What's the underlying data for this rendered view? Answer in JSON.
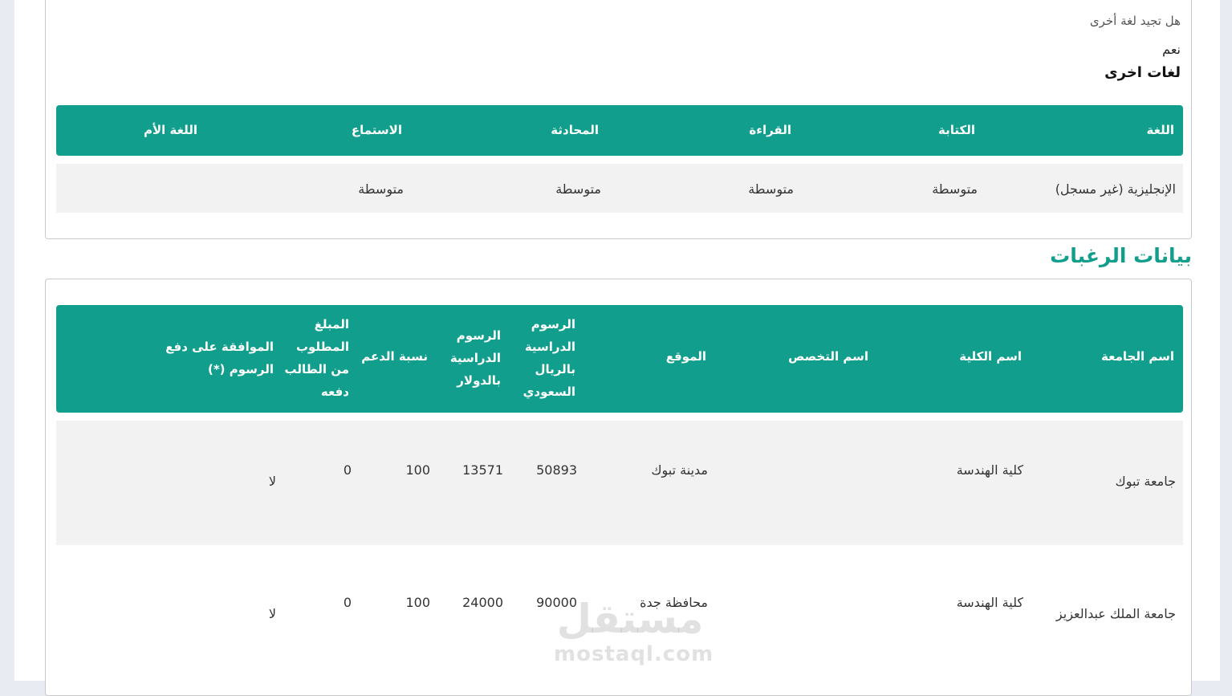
{
  "languages_section": {
    "question_label": "هل تجيد لغة أخرى",
    "question_value": "نعم",
    "subtitle": "لغات اخرى",
    "headers": [
      "اللغة",
      "الكتابة",
      "القراءة",
      "المحادثة",
      "الاستماع",
      "اللغة الأم"
    ],
    "rows": [
      {
        "language": "الإنجليزية  (غير مسجل)",
        "writing": "متوسطة",
        "reading": "متوسطة",
        "speaking": "متوسطة",
        "listening": "متوسطة",
        "native": ""
      }
    ]
  },
  "preferences_section": {
    "title": "بيانات الرغبات",
    "headers": {
      "university": "اسم الجامعة",
      "college": "اسم الكلية",
      "major": "اسم التخصص",
      "location": "الموقع",
      "fees_sar_lines": [
        "الرسوم",
        "الدراسية",
        "بالريال",
        "السعودي"
      ],
      "fees_usd_lines": [
        "الرسوم",
        "الدراسية",
        "بالدولار"
      ],
      "support": "نسبة الدعم",
      "amount_lines": [
        "المبلغ",
        "المطلوب",
        "من الطالب",
        "دفعه"
      ],
      "agree_lines": [
        "الموافقة على دفع",
        "الرسوم (*)"
      ]
    },
    "rows": [
      {
        "university": "جامعة تبوك",
        "college": "كلية الهندسة",
        "major": "",
        "location": "مدينة تبوك",
        "fees_sar": "50893",
        "fees_usd": "13571",
        "support": "100",
        "amount": "0",
        "agree": "لا"
      },
      {
        "university": "جامعة الملك عبدالعزيز",
        "college": "كلية الهندسة",
        "major": "",
        "location": "محافظة جدة",
        "fees_sar": "90000",
        "fees_usd": "24000",
        "support": "100",
        "amount": "0",
        "agree": "لا"
      }
    ]
  },
  "watermark": {
    "arabic": "مستقل",
    "latin": "mostaql.com"
  }
}
